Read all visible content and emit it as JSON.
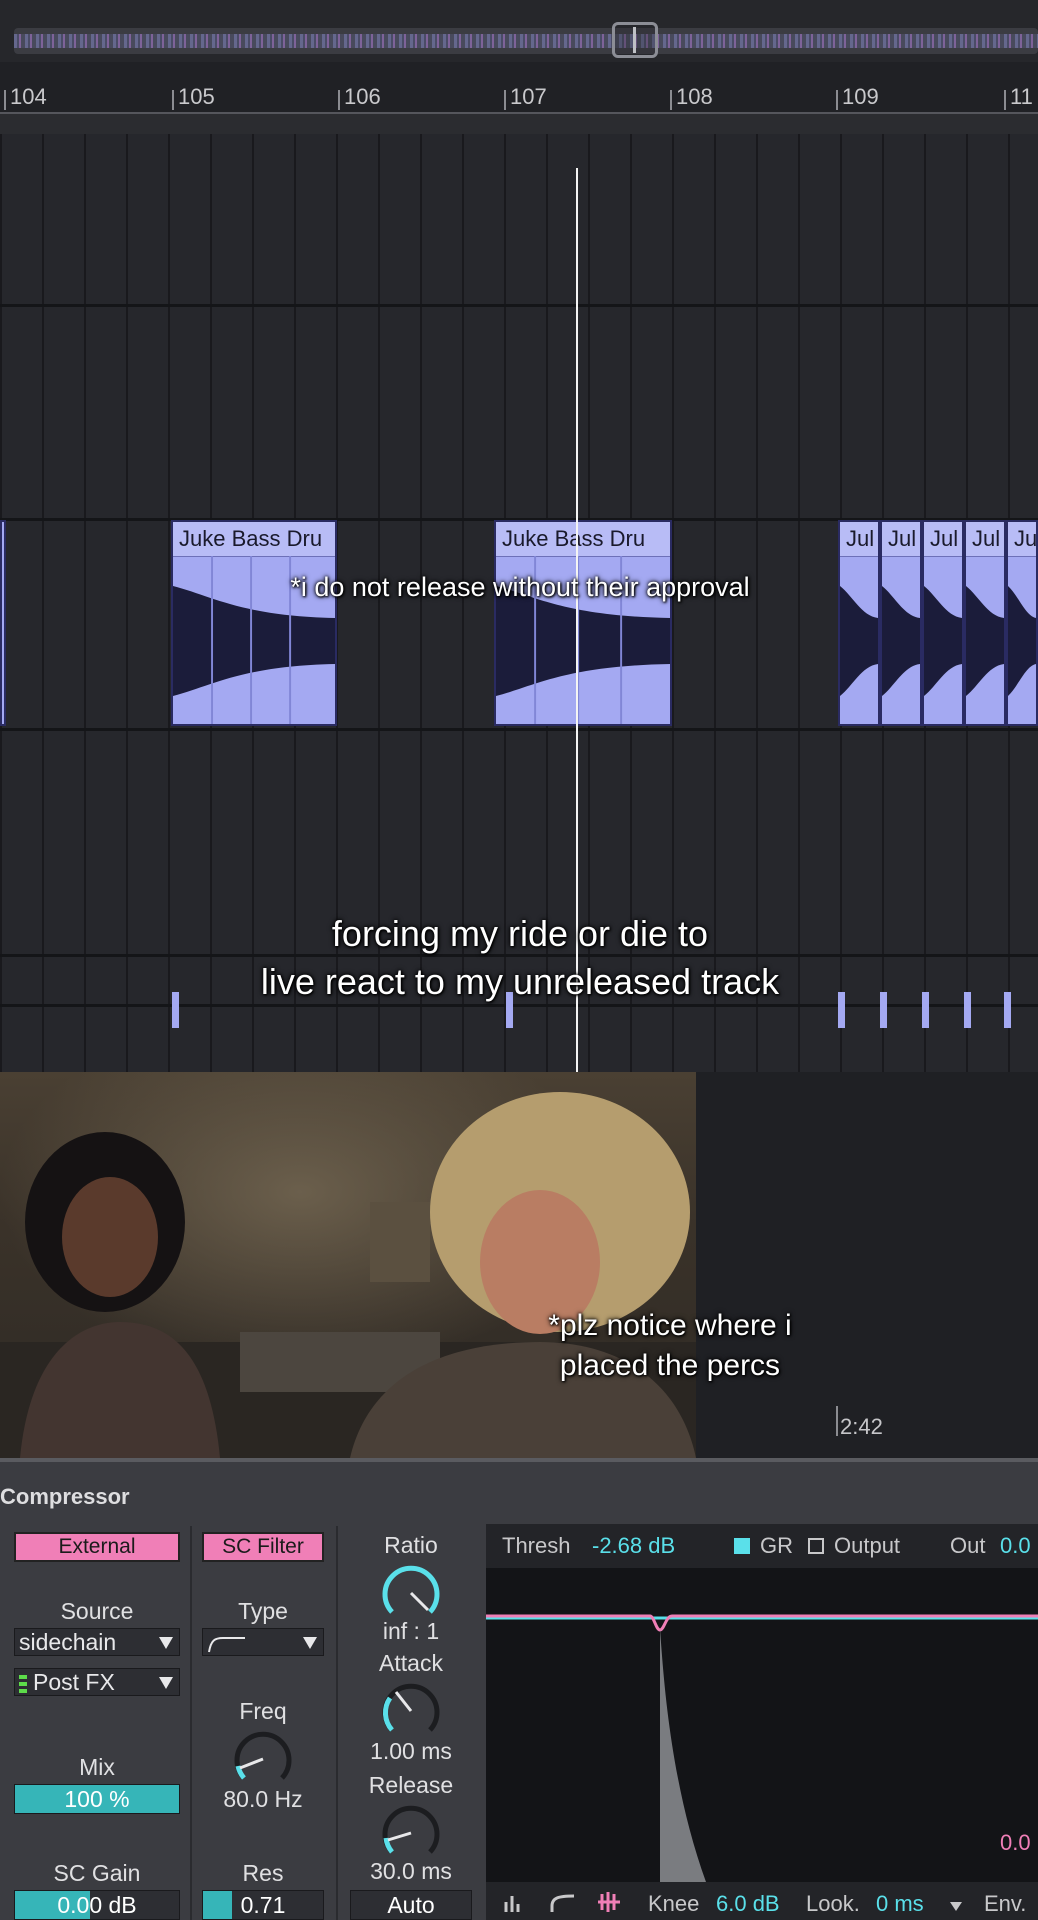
{
  "ruler": {
    "bars": [
      "104",
      "105",
      "106",
      "107",
      "108",
      "109",
      "11"
    ]
  },
  "clips": [
    {
      "label": "Juke Bass Dru"
    },
    {
      "label": "Juke Bass Dru"
    },
    {
      "label": "Jul"
    },
    {
      "label": "Jul"
    },
    {
      "label": "Jul"
    },
    {
      "label": "Jul"
    },
    {
      "label": "Ju"
    }
  ],
  "captions": {
    "approval": "*i do not release without their approval",
    "main_line1": "forcing my ride or die to",
    "main_line2": "live react to my unreleased track",
    "percs_line1": "*plz notice where i",
    "percs_line2": "placed the percs"
  },
  "timeline": {
    "time_marker": "2:42"
  },
  "compressor": {
    "title": "Compressor",
    "external_label": "External",
    "sc_filter_label": "SC Filter",
    "source_label": "Source",
    "source_value": "sidechain",
    "post_fx_value": "Post FX",
    "type_label": "Type",
    "freq_label": "Freq",
    "freq_value": "80.0 Hz",
    "mix_label": "Mix",
    "mix_value": "100 %",
    "mix_fraction": 1.0,
    "sc_gain_label": "SC Gain",
    "sc_gain_value": "0.00 dB",
    "res_label": "Res",
    "res_value": "0.71",
    "ratio_label": "Ratio",
    "ratio_value": "inf : 1",
    "attack_label": "Attack",
    "attack_value": "1.00 ms",
    "release_label": "Release",
    "release_value": "30.0 ms",
    "auto_label": "Auto",
    "display": {
      "thresh_label": "Thresh",
      "thresh_value": "-2.68 dB",
      "gr_label": "GR",
      "output_label": "Output",
      "out_label": "Out",
      "out_value": "0.0",
      "right_value": "0.0",
      "knee_label": "Knee",
      "knee_value": "6.0 dB",
      "look_label": "Look.",
      "look_value": "0 ms",
      "env_label": "Env."
    },
    "colors": {
      "accent_pink": "#f07fb7",
      "accent_cyan": "#5ae0ea",
      "clip": "#a4a9f2"
    }
  }
}
